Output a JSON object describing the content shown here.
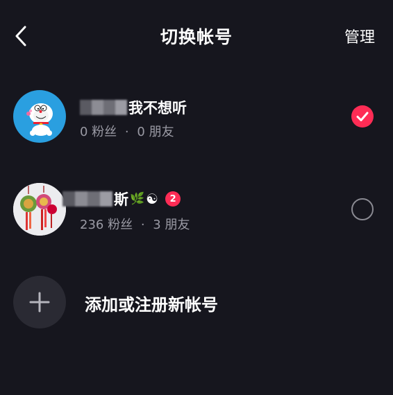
{
  "header": {
    "title": "切换帐号",
    "manage_label": "管理"
  },
  "accounts": [
    {
      "name_visible": "我不想听",
      "followers_text": "0 粉丝",
      "dot": "·",
      "friends_text": "0 朋友",
      "selected": true,
      "avatar_icon": "doraemon-avatar"
    },
    {
      "name_visible": "斯",
      "name_emoji": "🌿",
      "name_emoji_2": "☯",
      "badge": "2",
      "followers_text": "236 粉丝",
      "dot": "·",
      "friends_text": "3 朋友",
      "selected": false,
      "avatar_icon": "hanging-ornament-avatar"
    }
  ],
  "add_account": {
    "label": "添加或注册新帐号",
    "icon": "plus-icon"
  },
  "colors": {
    "background": "#16161e",
    "accent": "#fe2c55",
    "muted_text": "#9a9aa4"
  }
}
